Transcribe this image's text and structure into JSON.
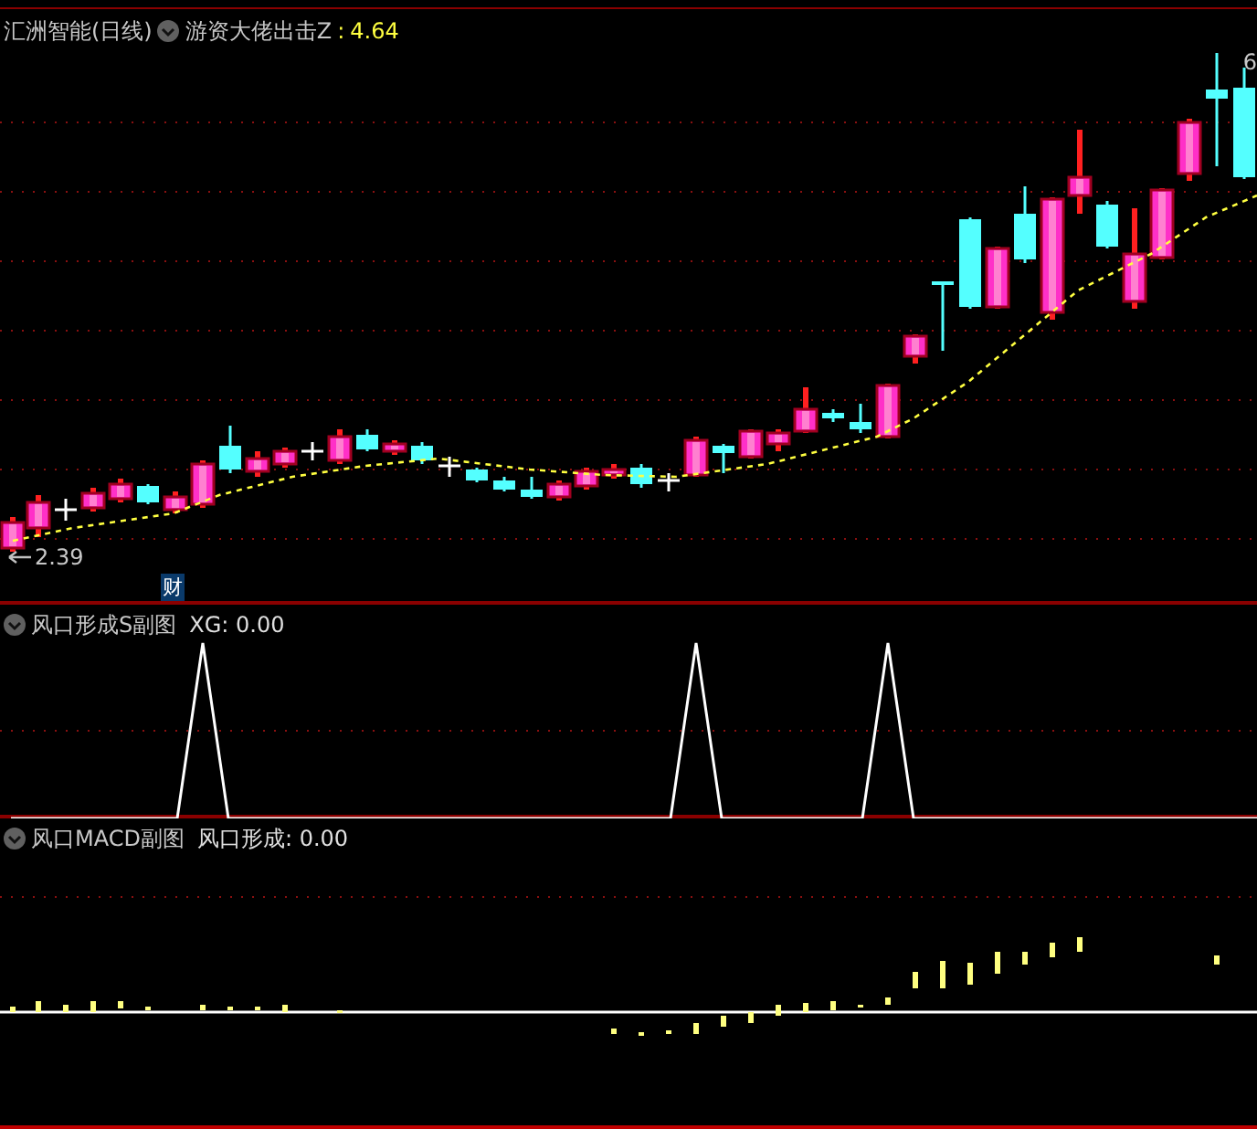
{
  "main_panel": {
    "stock_name": "汇洲智能(日线)",
    "indicator": "游资大佬出击Z",
    "separator": ":",
    "indicator_value": "4.64",
    "low_label": "2.39",
    "high_label": "6",
    "badge": "财"
  },
  "panels": [
    {
      "title": "风口形成S副图",
      "reading": "XG: 0.00"
    },
    {
      "title": "风口MACD副图",
      "reading": "风口形成: 0.00"
    }
  ]
}
